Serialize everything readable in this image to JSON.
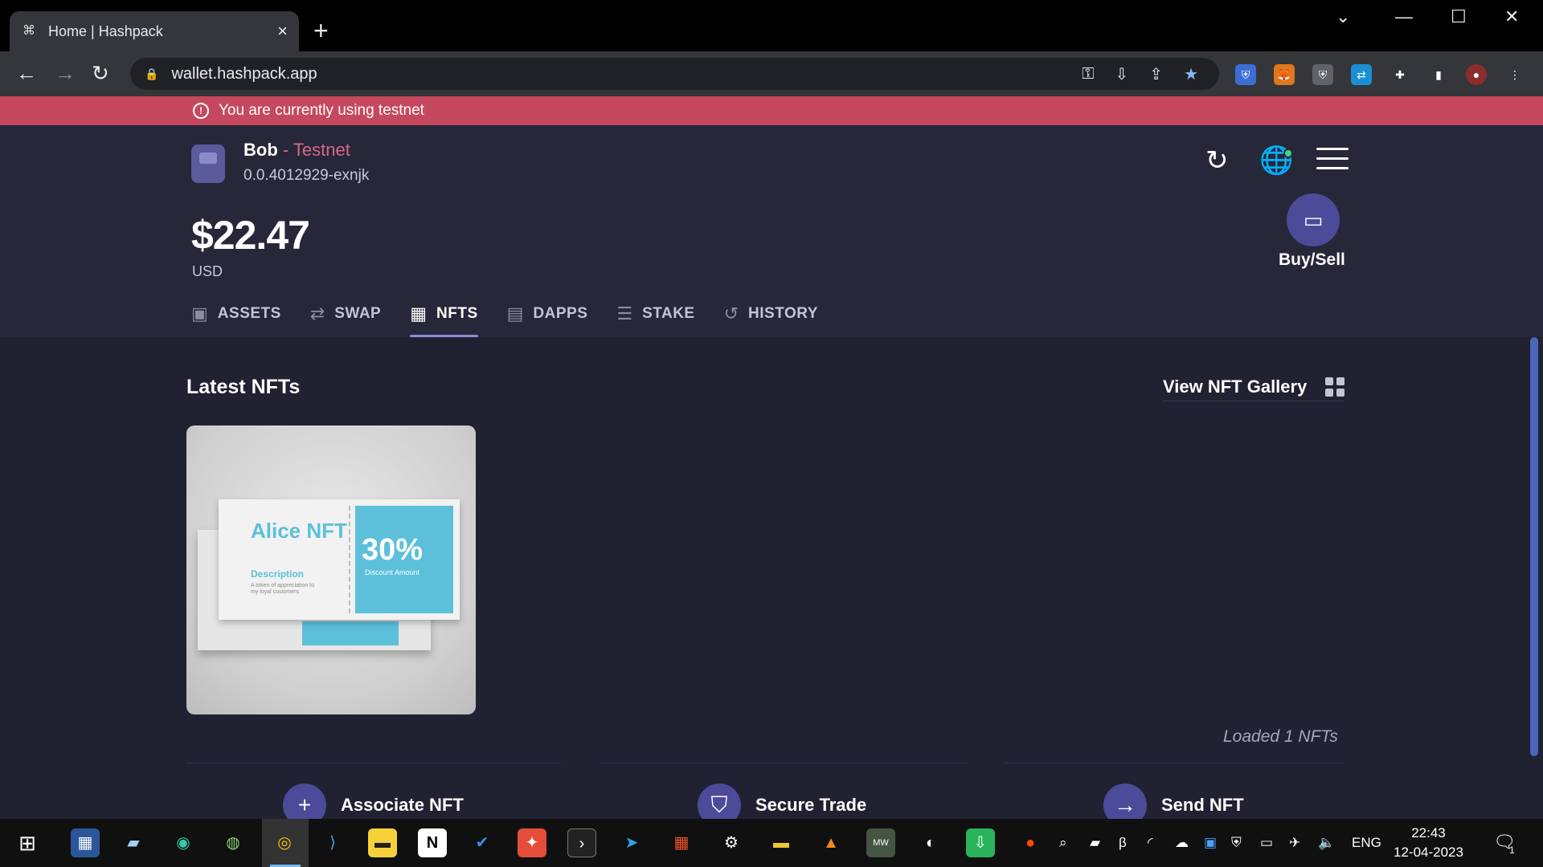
{
  "browser": {
    "tab_title": "Home | Hashpack",
    "url": "wallet.hashpack.app"
  },
  "banner": {
    "text": "You are currently using testnet"
  },
  "account": {
    "name": "Bob",
    "network_label": " - Testnet",
    "account_id": "0.0.4012929-exnjk",
    "balance": "$22.47",
    "currency": "USD"
  },
  "buysell": {
    "label": "Buy/Sell"
  },
  "tabs": [
    {
      "label": "ASSETS",
      "icon": "wallet-icon"
    },
    {
      "label": "SWAP",
      "icon": "swap-arrows-icon"
    },
    {
      "label": "NFTS",
      "icon": "grid-icon"
    },
    {
      "label": "DAPPS",
      "icon": "browser-icon"
    },
    {
      "label": "STAKE",
      "icon": "coins-icon"
    },
    {
      "label": "HISTORY",
      "icon": "history-icon"
    }
  ],
  "active_tab": "NFTS",
  "nfts": {
    "section_title": "Latest NFTs",
    "gallery_link": "View NFT Gallery",
    "loaded_text": "Loaded 1 NFTs",
    "items": [
      {
        "ticket_title": "Alice NFT",
        "ticket_description": "Description",
        "ticket_subtext": "A token of appreciation to my loyal customers",
        "ticket_value": "30%",
        "ticket_value_label": "Discount Amount"
      }
    ]
  },
  "actions": [
    {
      "label": "Associate NFT",
      "icon": "plus-icon"
    },
    {
      "label": "Secure Trade",
      "icon": "shield-icon"
    },
    {
      "label": "Send NFT",
      "icon": "arrow-right-icon"
    }
  ],
  "taskbar": {
    "language": "ENG",
    "time": "22:43",
    "date": "12-04-2023",
    "notification_count": "1"
  },
  "colors": {
    "banner": "#c6485e",
    "header_bg": "#262739",
    "content_bg": "#202131",
    "accent": "#4b4b9a",
    "testnet_text": "#d8688a",
    "active_tab_underline": "#8d8fd9"
  }
}
